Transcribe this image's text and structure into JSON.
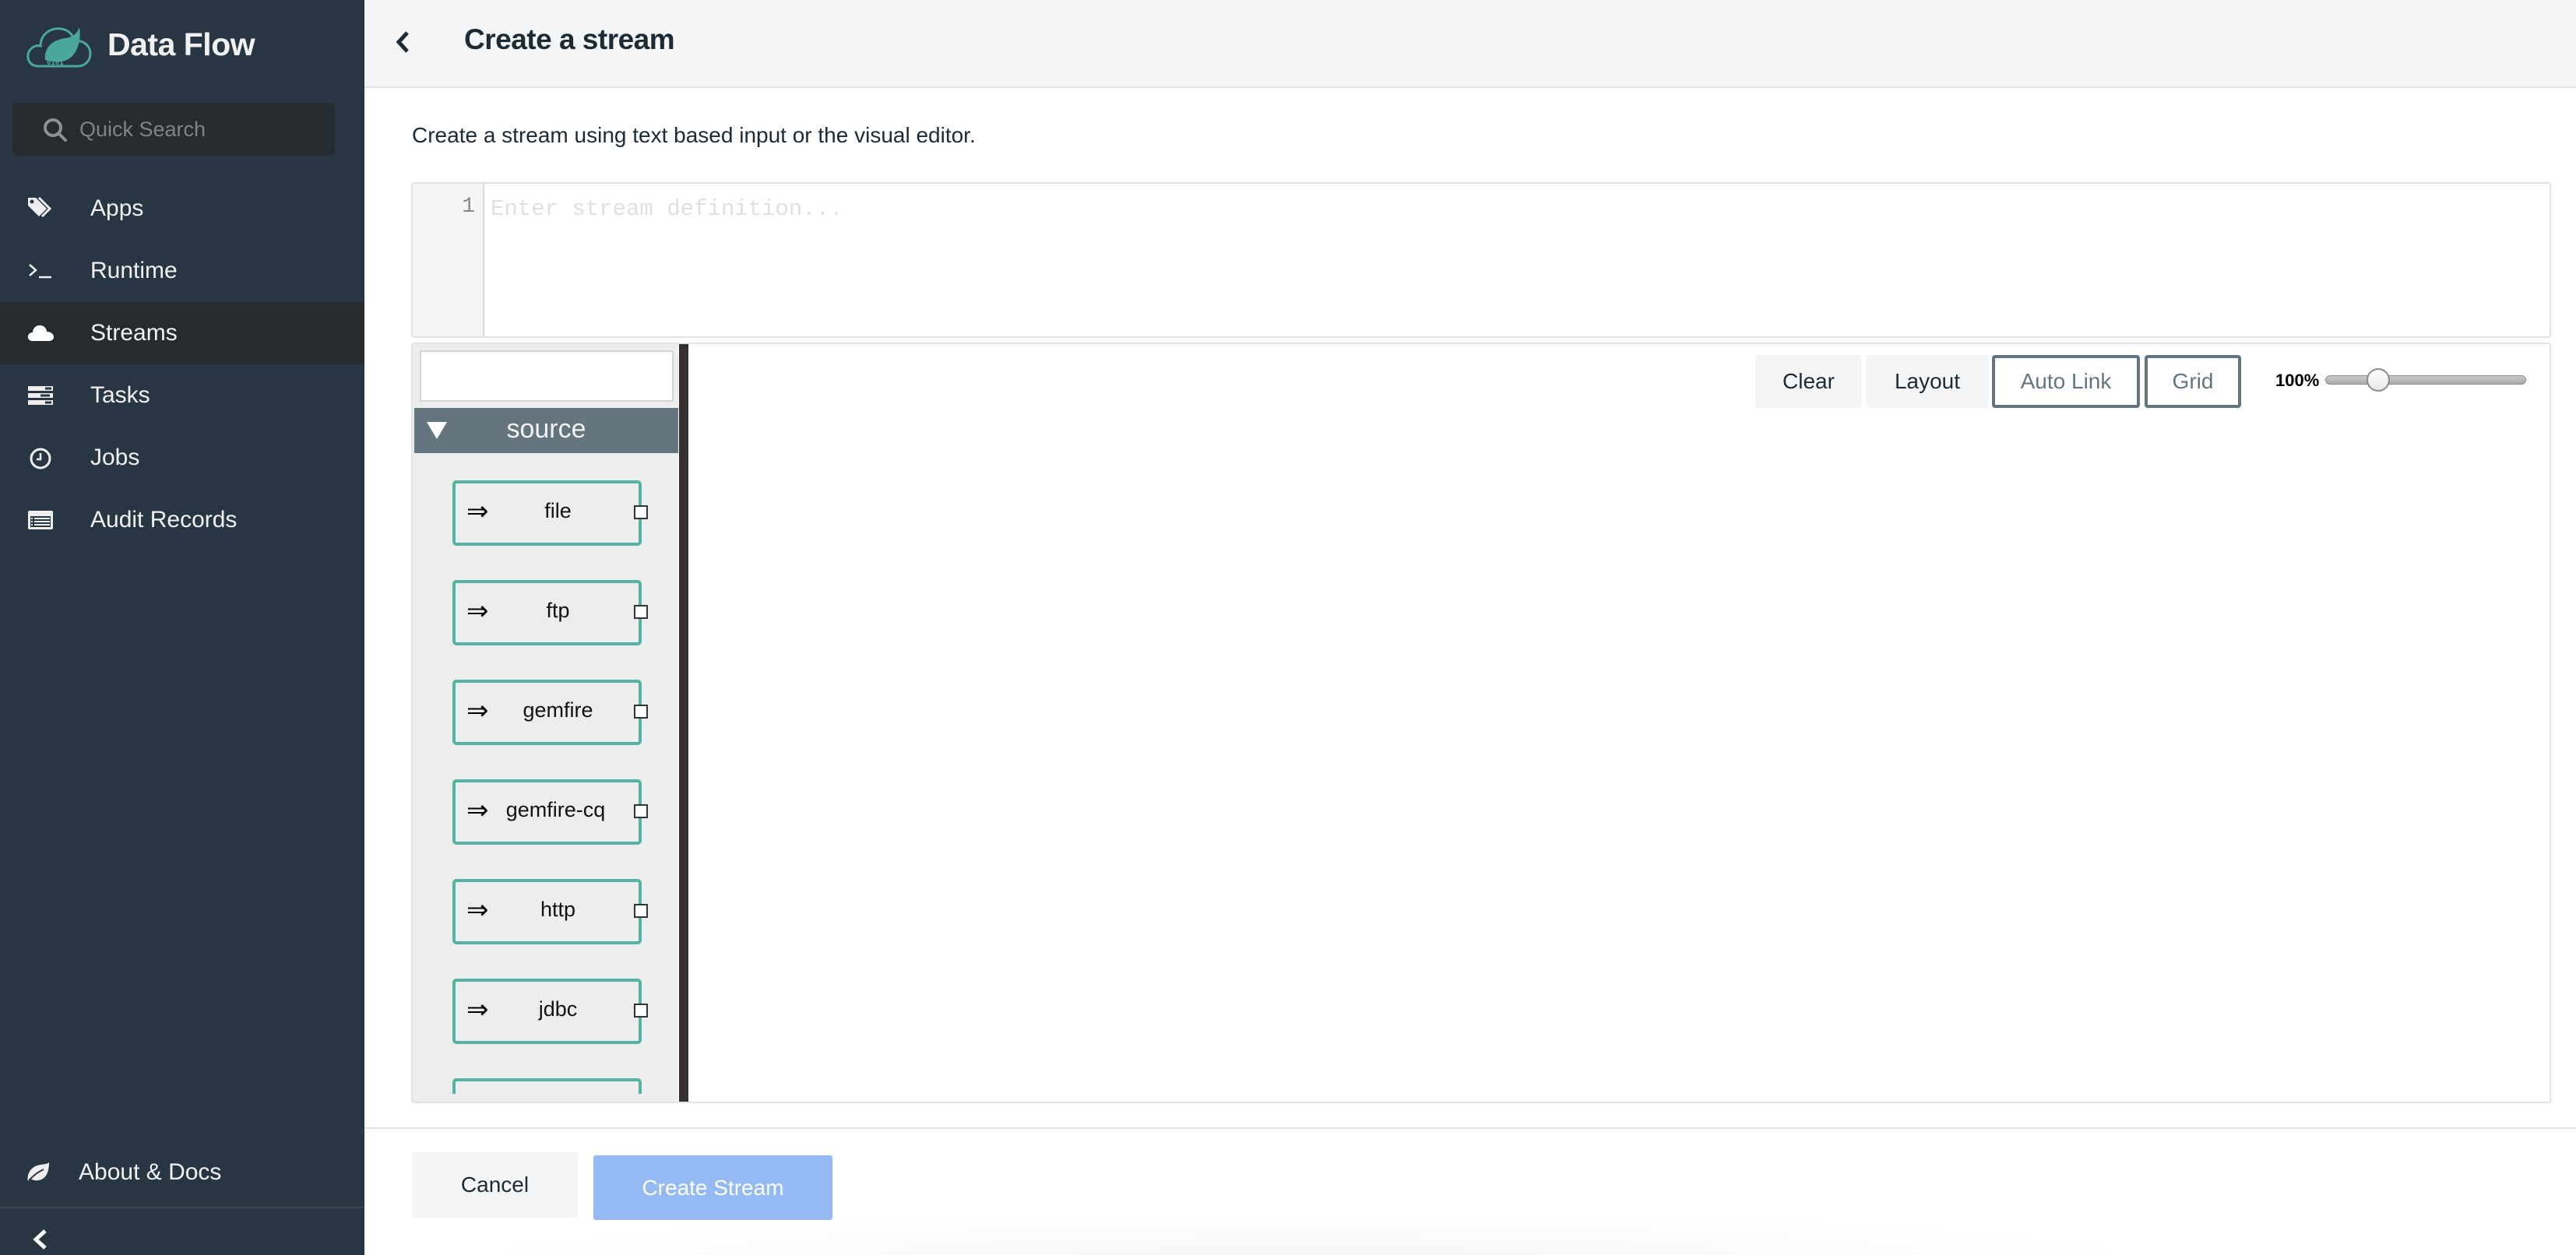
{
  "app": {
    "title": "Data Flow",
    "logo_icon": "spring-cloud-data-flow-logo",
    "brand_color": "#4aa89a"
  },
  "sidebar": {
    "search": {
      "placeholder": "Quick Search",
      "value": "",
      "icon": "search-icon"
    },
    "items": [
      {
        "label": "Apps",
        "icon": "tags-icon",
        "active": false
      },
      {
        "label": "Runtime",
        "icon": "terminal-icon",
        "active": false
      },
      {
        "label": "Streams",
        "icon": "cloud-icon",
        "active": true
      },
      {
        "label": "Tasks",
        "icon": "tasks-icon",
        "active": false
      },
      {
        "label": "Jobs",
        "icon": "clock-icon",
        "active": false
      },
      {
        "label": "Audit Records",
        "icon": "list-icon",
        "active": false
      }
    ],
    "footer": {
      "label": "About & Docs",
      "icon": "leaf-icon"
    },
    "collapse_icon": "chevron-left-icon"
  },
  "header": {
    "back_icon": "chevron-left-icon",
    "title": "Create a stream"
  },
  "intro_text": "Create a stream using text based input or the visual editor.",
  "dsl_editor": {
    "line_numbers": [
      "1"
    ],
    "value": "",
    "placeholder": "Enter stream definition..."
  },
  "palette": {
    "filter_value": "",
    "groups": [
      {
        "label": "source",
        "expanded": true,
        "items": [
          {
            "label": "file",
            "icon": "double-arrow-icon",
            "glyph": "⇒"
          },
          {
            "label": "ftp",
            "icon": "double-arrow-icon",
            "glyph": "⇒"
          },
          {
            "label": "gemfire",
            "icon": "double-arrow-icon",
            "glyph": "⇒"
          },
          {
            "label": "gemfire-cq",
            "icon": "double-arrow-icon",
            "glyph": "⇒"
          },
          {
            "label": "http",
            "icon": "double-arrow-icon",
            "glyph": "⇒"
          },
          {
            "label": "jdbc",
            "icon": "double-arrow-icon",
            "glyph": "⇒"
          },
          {
            "label": "",
            "icon": "double-arrow-icon",
            "glyph": ""
          }
        ]
      }
    ],
    "node_color": "#55b2a5"
  },
  "canvas_toolbar": {
    "clear_label": "Clear",
    "layout_label": "Layout",
    "auto_link_label": "Auto Link",
    "grid_label": "Grid",
    "zoom": {
      "label": "100%",
      "value_percent": 100,
      "slider_fraction": 0.26
    }
  },
  "footer": {
    "cancel_label": "Cancel",
    "create_label": "Create Stream",
    "create_enabled": false,
    "create_color": "#95b9f2"
  }
}
